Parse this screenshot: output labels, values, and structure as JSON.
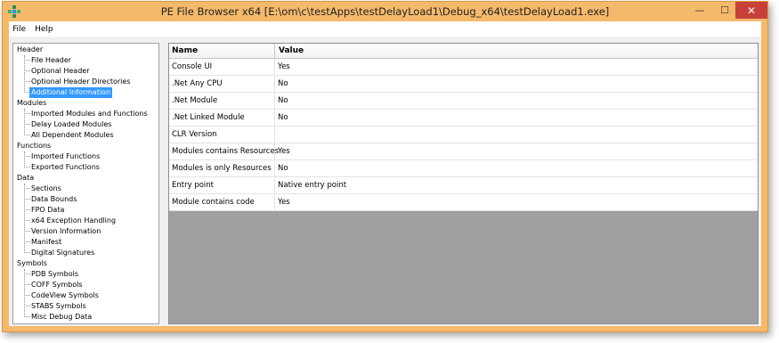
{
  "window": {
    "title": "PE File Browser x64 [E:\\om\\c\\testApps\\testDelayLoad1\\Debug_x64\\testDelayLoad1.exe]",
    "accent": "#f5b96b",
    "close_color": "#c7413a",
    "minimize_glyph": "—",
    "maximize_glyph": "☐",
    "close_glyph": "✕"
  },
  "menu": {
    "file": "File",
    "help": "Help"
  },
  "tree": {
    "header": "Header",
    "file_header": "File Header",
    "optional_header": "Optional Header",
    "optional_header_directories": "Optional Header Directories",
    "additional_information": "Additional Information",
    "modules": "Modules",
    "imported_modules": "Imported Modules and Functions",
    "delay_loaded_modules": "Delay Loaded Modules",
    "all_dependent_modules": "All Dependent Modules",
    "functions": "Functions",
    "imported_functions": "Imported Functions",
    "exported_functions": "Exported Functions",
    "data": "Data",
    "sections": "Sections",
    "data_bounds": "Data Bounds",
    "fpo_data": "FPO Data",
    "x64_exception_handling": "x64 Exception Handling",
    "version_information": "Version Information",
    "manifest": "Manifest",
    "digital_signatures": "Digital Signatures",
    "symbols": "Symbols",
    "pdb_symbols": "PDB Symbols",
    "coff_symbols": "COFF Symbols",
    "codeview_symbols": "CodeView Symbols",
    "stabs_symbols": "STABS Symbols",
    "misc_debug_data": "Misc Debug Data",
    "selected_color": "#3399ff"
  },
  "grid": {
    "columns": {
      "name": "Name",
      "value": "Value"
    },
    "rows": [
      {
        "name": "Console UI",
        "value": "Yes"
      },
      {
        "name": ".Net Any CPU",
        "value": "No"
      },
      {
        "name": ".Net Module",
        "value": "No"
      },
      {
        "name": ".Net Linked Module",
        "value": "No"
      },
      {
        "name": "CLR Version",
        "value": ""
      },
      {
        "name": "Modules contains Resources",
        "value": "Yes"
      },
      {
        "name": "Modules is only Resources",
        "value": "No"
      },
      {
        "name": "Entry point",
        "value": "Native entry point"
      },
      {
        "name": "Module contains code",
        "value": "Yes"
      }
    ]
  }
}
